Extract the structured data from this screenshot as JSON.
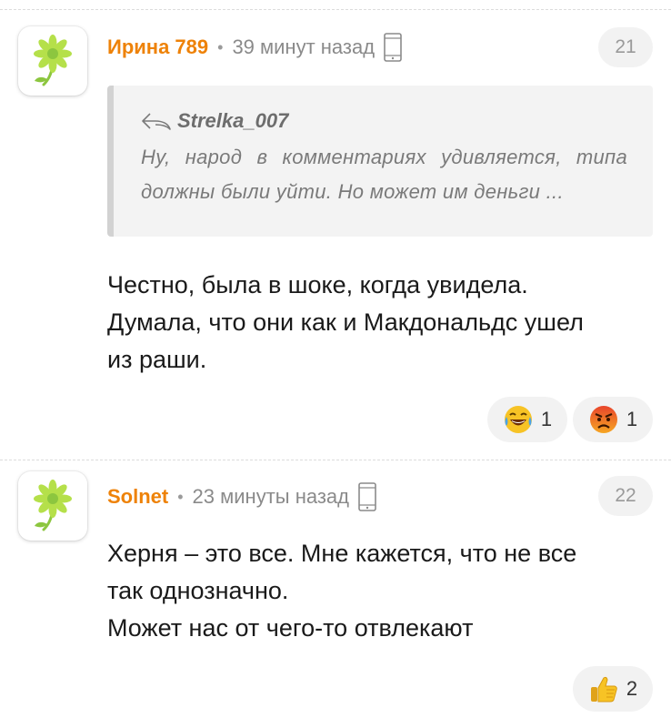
{
  "comments": [
    {
      "author": "Ирина 789",
      "separator": "•",
      "time": "39 минут назад",
      "device_icon": "phone-icon",
      "rating": "21",
      "quote": {
        "reply_icon": "reply-arrow-icon",
        "author": "Strelka_007",
        "text": "Ну, народ в комментариях удивляется, типа должны были уйти. Но может им деньги ..."
      },
      "body_lines": [
        "Честно, была в шоке, когда увидела.",
        "Думала, что они как и Макдональдс ушел",
        "из раши."
      ],
      "reactions": [
        {
          "icon": "laughing-tears-emoji-icon",
          "count": "1"
        },
        {
          "icon": "angry-face-emoji-icon",
          "count": "1"
        }
      ]
    },
    {
      "author": "Solnet",
      "separator": "•",
      "time": "23 минуты назад",
      "device_icon": "phone-icon",
      "rating": "22",
      "body_lines": [
        "Херня – это все. Мне кажется, что не все",
        "так однозначно.",
        "Может нас от чего-то отвлекают"
      ],
      "reactions": [
        {
          "icon": "thumbs-up-emoji-icon",
          "count": "2"
        }
      ]
    }
  ],
  "colors": {
    "author": "#ee8208",
    "muted": "#8a8a8a",
    "quote_bg": "#f3f3f3",
    "avatar_flower": "#a5d63a"
  }
}
